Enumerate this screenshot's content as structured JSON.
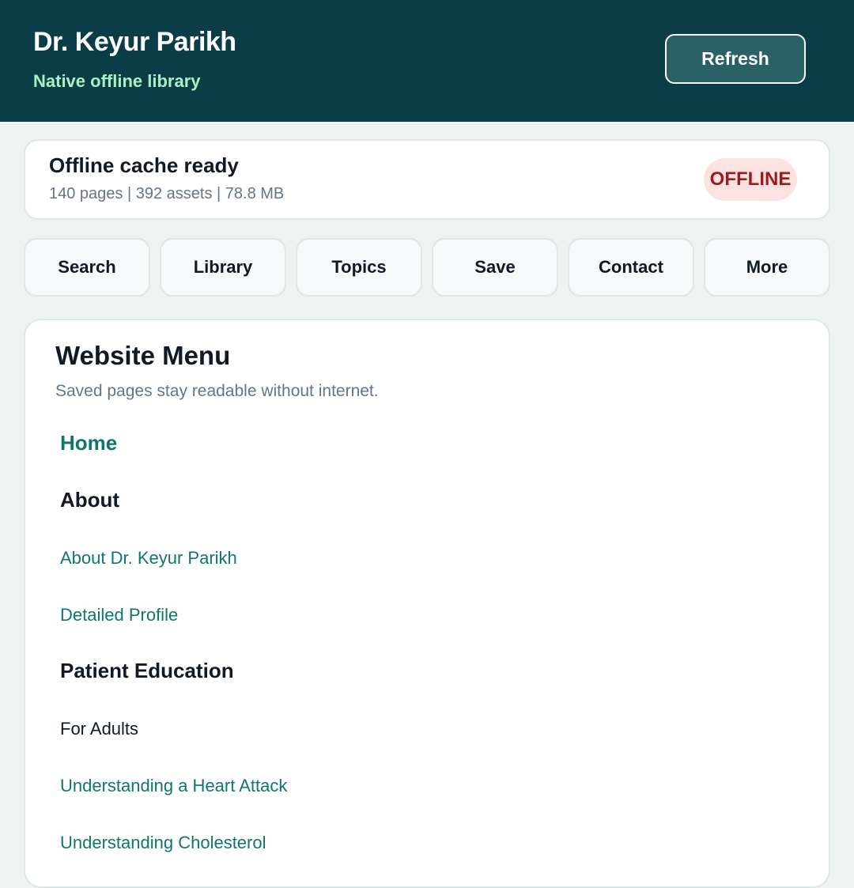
{
  "header": {
    "title": "Dr. Keyur Parikh",
    "subtitle": "Native offline library",
    "refresh_label": "Refresh"
  },
  "status": {
    "title": "Offline cache ready",
    "meta": "140 pages | 392 assets | 78.8 MB",
    "badge": "OFFLINE"
  },
  "tabs": [
    {
      "label": "Search"
    },
    {
      "label": "Library"
    },
    {
      "label": "Topics"
    },
    {
      "label": "Save"
    },
    {
      "label": "Contact"
    },
    {
      "label": "More"
    }
  ],
  "menu": {
    "title": "Website Menu",
    "subtitle": "Saved pages stay readable without internet.",
    "items": [
      {
        "label": "Home"
      },
      {
        "label": "About"
      },
      {
        "label": "About Dr. Keyur Parikh"
      },
      {
        "label": "Detailed Profile"
      },
      {
        "label": "Patient Education"
      },
      {
        "label": "For Adults"
      },
      {
        "label": "Understanding a Heart Attack"
      },
      {
        "label": "Understanding Cholesterol"
      }
    ]
  },
  "colors": {
    "header_bg": "#0b3d48",
    "accent": "#0f766e",
    "subtitle_green": "#a7f3c0",
    "badge_bg": "#fde2e2",
    "badge_text": "#9b1c1c"
  }
}
